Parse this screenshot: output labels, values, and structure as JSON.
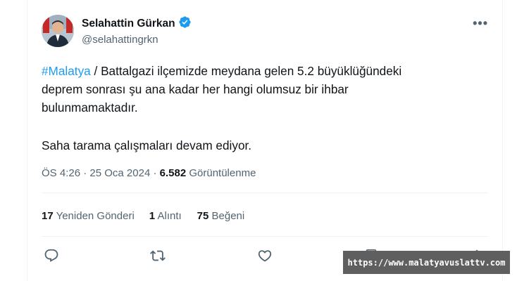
{
  "author": {
    "display_name": "Selahattin Gürkan",
    "handle": "@selahattingrkn",
    "verified_icon": "verified-badge-icon"
  },
  "tweet": {
    "hashtag": "#Malatya",
    "line1_rest": " / Battalgazi ilçemizde meydana gelen 5.2 büyüklüğündeki",
    "line2": "deprem sonrası şu ana kadar her hangi olumsuz bir ihbar",
    "line3": "bulunmamaktadır.",
    "line4": "Saha tarama çalışmaları devam ediyor."
  },
  "meta": {
    "time": "ÖS 4:26",
    "separator1": " · ",
    "date": "25 Oca 2024",
    "separator2": " · ",
    "views_count": "6.582",
    "views_label": " Görüntülenme"
  },
  "stats": {
    "retweets_count": "17",
    "retweets_label": " Yeniden Gönderi",
    "quotes_count": "1",
    "quotes_label": " Alıntı",
    "likes_count": "75",
    "likes_label": " Beğeni"
  },
  "actions": [
    "reply-icon",
    "retweet-icon",
    "like-icon",
    "bookmark-icon",
    "share-icon"
  ],
  "watermark": {
    "text": "https://www.malatyavuslattv.com"
  },
  "colors": {
    "link": "#1d9bf0",
    "secondary": "#536471",
    "verified": "#1d9bf0"
  }
}
